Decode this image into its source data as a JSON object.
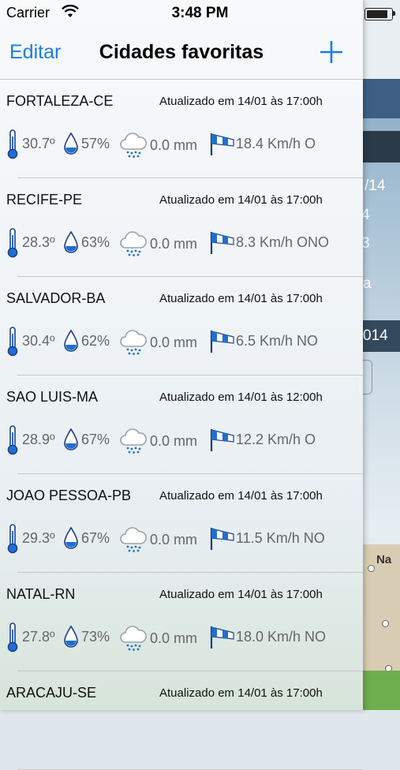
{
  "status_bar": {
    "carrier": "Carrier",
    "time": "3:48 PM"
  },
  "nav": {
    "edit_label": "Editar",
    "title": "Cidades favoritas",
    "add_icon": "plus-icon"
  },
  "colors": {
    "accent": "#1a7fde",
    "icon_blue": "#1f6fd0"
  },
  "cities": [
    {
      "name": "FORTALEZA-CE",
      "updated": "Atualizado em 14/01 às 17:00h",
      "temp": "30.7º",
      "humidity": "57%",
      "rain": "0.0 mm",
      "wind": "18.4 Km/h O"
    },
    {
      "name": "RECIFE-PE",
      "updated": "Atualizado em 14/01 às 17:00h",
      "temp": "28.3º",
      "humidity": "63%",
      "rain": "0.0 mm",
      "wind": "8.3 Km/h ONO"
    },
    {
      "name": "SALVADOR-BA",
      "updated": "Atualizado em 14/01 às 17:00h",
      "temp": "30.4º",
      "humidity": "62%",
      "rain": "0.0 mm",
      "wind": "6.5 Km/h NO"
    },
    {
      "name": "SAO LUIS-MA",
      "updated": "Atualizado em 14/01 às 12:00h",
      "temp": "28.9º",
      "humidity": "67%",
      "rain": "0.0 mm",
      "wind": "12.2 Km/h O"
    },
    {
      "name": "JOAO PESSOA-PB",
      "updated": "Atualizado em 14/01 às 17:00h",
      "temp": "29.3º",
      "humidity": "67%",
      "rain": "0.0 mm",
      "wind": "11.5 Km/h NO"
    },
    {
      "name": "NATAL-RN",
      "updated": "Atualizado em 14/01 às 17:00h",
      "temp": "27.8º",
      "humidity": "73%",
      "rain": "0.0 mm",
      "wind": "18.0 Km/h NO"
    },
    {
      "name": "ARACAJU-SE",
      "updated": "Atualizado em 14/01 às 17:00h"
    }
  ],
  "background_app": {
    "fragments": [
      "/14",
      "4",
      "3",
      "a",
      "014"
    ],
    "map_label": "Na"
  }
}
